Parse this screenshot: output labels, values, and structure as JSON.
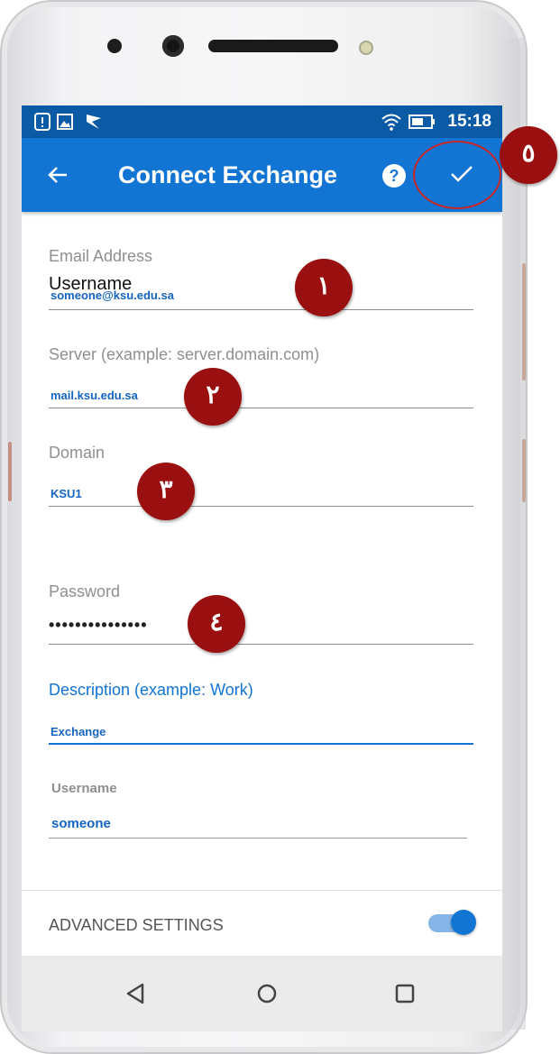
{
  "status_bar": {
    "time": "15:18",
    "left_icons": [
      "alert-icon",
      "image-icon",
      "flag-icon"
    ],
    "right_icons": [
      "wifi-icon",
      "battery-icon"
    ]
  },
  "app_bar": {
    "title": "Connect Exchange",
    "back_icon": "arrow-left-icon",
    "help_icon": "question-icon",
    "confirm_icon": "check-icon"
  },
  "form": {
    "email": {
      "label": "Email Address",
      "overlay_text": "Username",
      "value": "someone@ksu.edu.sa"
    },
    "server": {
      "label": "Server (example: server.domain.com)",
      "value": "mail.ksu.edu.sa"
    },
    "domain": {
      "label": "Domain",
      "value": "KSU1"
    },
    "password": {
      "label": "Password",
      "value": "•••••••••••••••"
    },
    "description": {
      "label": "Description (example: Work)",
      "value": "Exchange"
    },
    "username": {
      "label": "Username",
      "value": "someone"
    }
  },
  "advanced": {
    "label": "ADVANCED SETTINGS",
    "toggle_on": true
  },
  "annotations": {
    "badge1": "١",
    "badge2": "٢",
    "badge3": "٣",
    "badge4": "٤",
    "badge5": "٥"
  },
  "nav_bar": {
    "icons": [
      "back-triangle-icon",
      "home-circle-icon",
      "recents-square-icon"
    ]
  },
  "colors": {
    "primary": "#1274d3",
    "status_bar": "#0a5aa6",
    "badge": "#9a1010",
    "value_text": "#1565c0"
  }
}
